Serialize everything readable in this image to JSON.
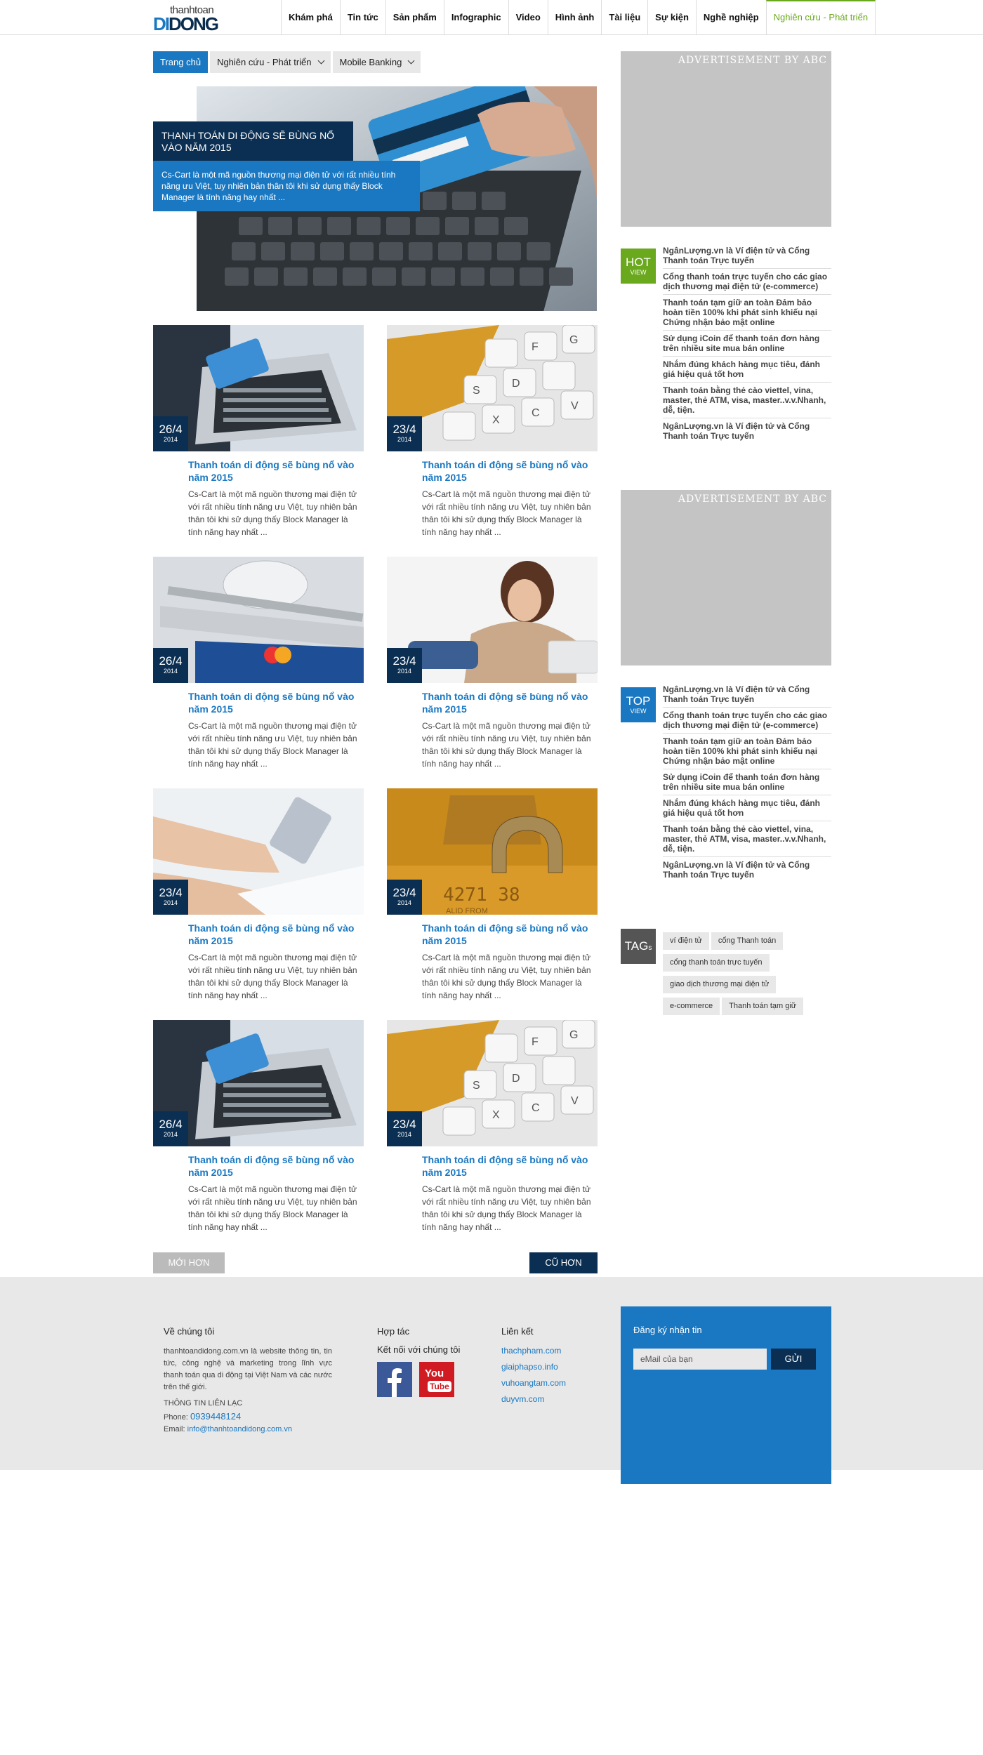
{
  "logo": {
    "line1": "thanhtoan",
    "di": "DI",
    "dong": "DONG"
  },
  "nav": {
    "items": [
      "Khám phá",
      "Tin tức",
      "Sản phẩm",
      "Infographic",
      "Video",
      "Hình ảnh",
      "Tài liệu",
      "Sự kiện",
      "Nghề nghiệp",
      "Nghiên cứu - Phát triển"
    ]
  },
  "breadcrumb": {
    "home": "Trang chủ",
    "level1": "Nghiên cứu - Phát triển",
    "level2": "Mobile Banking"
  },
  "hero": {
    "title": "THANH TOÁN DI ĐỘNG SẼ BÙNG NỔ VÀO NĂM 2015",
    "desc": "Cs-Cart là một mã nguồn thương mại điện tử với rất nhiều tính năng ưu Việt, tuy nhiên bản thân tôi khi sử dụng thấy Block Manager là tính năng hay nhất ..."
  },
  "articles": [
    {
      "day": "26/4",
      "year": "2014",
      "title": "Thanh toán di động sẽ bùng nổ vào năm 2015",
      "summary": "Cs-Cart là một mã nguồn thương mại điện tử với rất nhiều tính năng ưu Việt, tuy nhiên bản thân tôi khi sử dụng thấy Block Manager là tính năng hay nhất ..."
    },
    {
      "day": "23/4",
      "year": "2014",
      "title": "Thanh toán di động sẽ bùng nổ vào năm 2015",
      "summary": "Cs-Cart là một mã nguồn thương mại điện tử với rất nhiều tính năng ưu Việt, tuy nhiên bản thân tôi khi sử dụng thấy Block Manager là tính năng hay nhất ..."
    },
    {
      "day": "26/4",
      "year": "2014",
      "title": "Thanh toán di động sẽ bùng nổ vào năm 2015",
      "summary": "Cs-Cart là một mã nguồn thương mại điện tử với rất nhiều tính năng ưu Việt, tuy nhiên bản thân tôi khi sử dụng thấy Block Manager là tính năng hay nhất ..."
    },
    {
      "day": "23/4",
      "year": "2014",
      "title": "Thanh toán di động sẽ bùng nổ vào năm 2015",
      "summary": "Cs-Cart là một mã nguồn thương mại điện tử với rất nhiều tính năng ưu Việt, tuy nhiên bản thân tôi khi sử dụng thấy Block Manager là tính năng hay nhất ..."
    },
    {
      "day": "23/4",
      "year": "2014",
      "title": "Thanh toán di động sẽ bùng nổ vào năm 2015",
      "summary": "Cs-Cart là một mã nguồn thương mại điện tử với rất nhiều tính năng ưu Việt, tuy nhiên bản thân tôi khi sử dụng thấy Block Manager là tính năng hay nhất ..."
    },
    {
      "day": "23/4",
      "year": "2014",
      "title": "Thanh toán di động sẽ bùng nổ vào năm 2015",
      "summary": "Cs-Cart là một mã nguồn thương mại điện tử với rất nhiều tính năng ưu Việt, tuy nhiên bản thân tôi khi sử dụng thấy Block Manager là tính năng hay nhất ..."
    },
    {
      "day": "26/4",
      "year": "2014",
      "title": "Thanh toán di động sẽ bùng nổ vào năm 2015",
      "summary": "Cs-Cart là một mã nguồn thương mại điện tử với rất nhiều tính năng ưu Việt, tuy nhiên bản thân tôi khi sử dụng thấy Block Manager là tính năng hay nhất ..."
    },
    {
      "day": "23/4",
      "year": "2014",
      "title": "Thanh toán di động sẽ bùng nổ vào năm 2015",
      "summary": "Cs-Cart là một mã nguồn thương mại điện tử với rất nhiều tính năng ưu Việt, tuy nhiên bản thân tôi khi sử dụng thấy Block Manager là tính năng hay nhất ..."
    }
  ],
  "pager": {
    "newer": "MỚI HƠN",
    "older": "CŨ HƠN"
  },
  "ads": {
    "label": "ADVERTISEMENT BY ABC"
  },
  "hot": {
    "badge": "HOT",
    "sub": "VIEW",
    "items": [
      "NgânLượng.vn là Ví điện tử và Cổng Thanh toán Trực tuyến",
      "Cổng thanh toán trực tuyến cho các giao dịch thương mại điện tử (e-commerce)",
      "Thanh toán tạm giữ an toàn Đảm bảo hoàn tiền 100% khi phát sinh khiếu nại Chứng nhận bảo mật online",
      "Sử dụng iCoin để thanh toán đơn hàng trên nhiều site mua bán online",
      "Nhắm đúng khách hàng mục tiêu, đánh giá hiệu quả tốt hơn",
      "Thanh toán bằng thẻ cào viettel, vina, master, thẻ ATM, visa, master..v.v.Nhanh, dễ, tiện.",
      "NgânLượng.vn là Ví điện tử và Cổng Thanh toán Trực tuyến"
    ]
  },
  "top": {
    "badge": "TOP",
    "sub": "VIEW",
    "items": [
      "NgânLượng.vn là Ví điện tử và Cổng Thanh toán Trực tuyến",
      "Cổng thanh toán trực tuyến cho các giao dịch thương mại điện tử (e-commerce)",
      "Thanh toán tạm giữ an toàn Đảm bảo hoàn tiền 100% khi phát sinh khiếu nại Chứng nhận bảo mật online",
      "Sử dụng iCoin để thanh toán đơn hàng trên nhiều site mua bán online",
      "Nhắm đúng khách hàng mục tiêu, đánh giá hiệu quả tốt hơn",
      "Thanh toán bằng thẻ cào viettel, vina, master, thẻ ATM, visa, master..v.v.Nhanh, dễ, tiện.",
      "NgânLượng.vn là Ví điện tử và Cổng Thanh toán Trực tuyến"
    ]
  },
  "tags": {
    "badge": "TAG",
    "badge_sub": "s",
    "items": [
      "ví điện tử",
      "cổng Thanh toán",
      "cổng thanh toán trực tuyến",
      "giao dịch thương mại điện tử",
      "e-commerce",
      "Thanh toán tạm giữ"
    ]
  },
  "footer": {
    "about_title": "Về chúng tôi",
    "about_text": "thanhtoandidong.com.vn là website thông tin, tin tức, công nghệ và marketing trong lĩnh vực thanh toán qua di động tại Việt Nam và các nước trên thế giới.",
    "contact_title": "THÔNG TIN LIÊN LẠC",
    "phone_label": "Phone:",
    "phone": "0939448124",
    "email_label": "Email:",
    "email": "info@thanhtoandidong.com.vn",
    "coop_title": "Hợp tác",
    "social_title": "Kết nối với chúng tôi",
    "links_title": "Liên kết",
    "links": [
      "thachpham.com",
      "giaiphapso.info",
      "vuhoangtam.com",
      "duyvm.com"
    ],
    "subscribe_title": "Đăng ký nhận tin",
    "email_placeholder": "eMail của bạn",
    "send": "GỬI",
    "youtube_you": "You",
    "youtube_tube": "Tube"
  },
  "colors": {
    "brand_blue": "#1a78c2",
    "navy": "#0b2f52",
    "green": "#6aa81e",
    "ad_gray": "#c4c4c4"
  }
}
